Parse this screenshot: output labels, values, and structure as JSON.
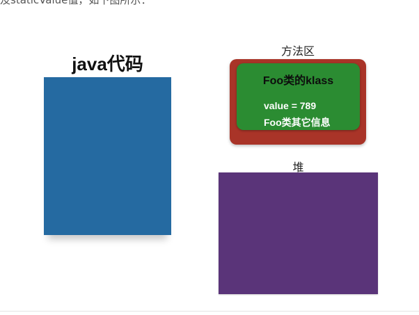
{
  "intro_text": "及staticValue值，如下图所示：",
  "java_section": {
    "title": "java代码",
    "color": "#256aa1"
  },
  "method_area": {
    "label": "方法区",
    "color": "#a93428",
    "klass": {
      "title": "Foo类的klass",
      "value_line": "value = 789",
      "other_line": "Foo类其它信息",
      "color": "#2b8c32"
    }
  },
  "heap": {
    "label": "堆",
    "color": "#5a3479"
  }
}
